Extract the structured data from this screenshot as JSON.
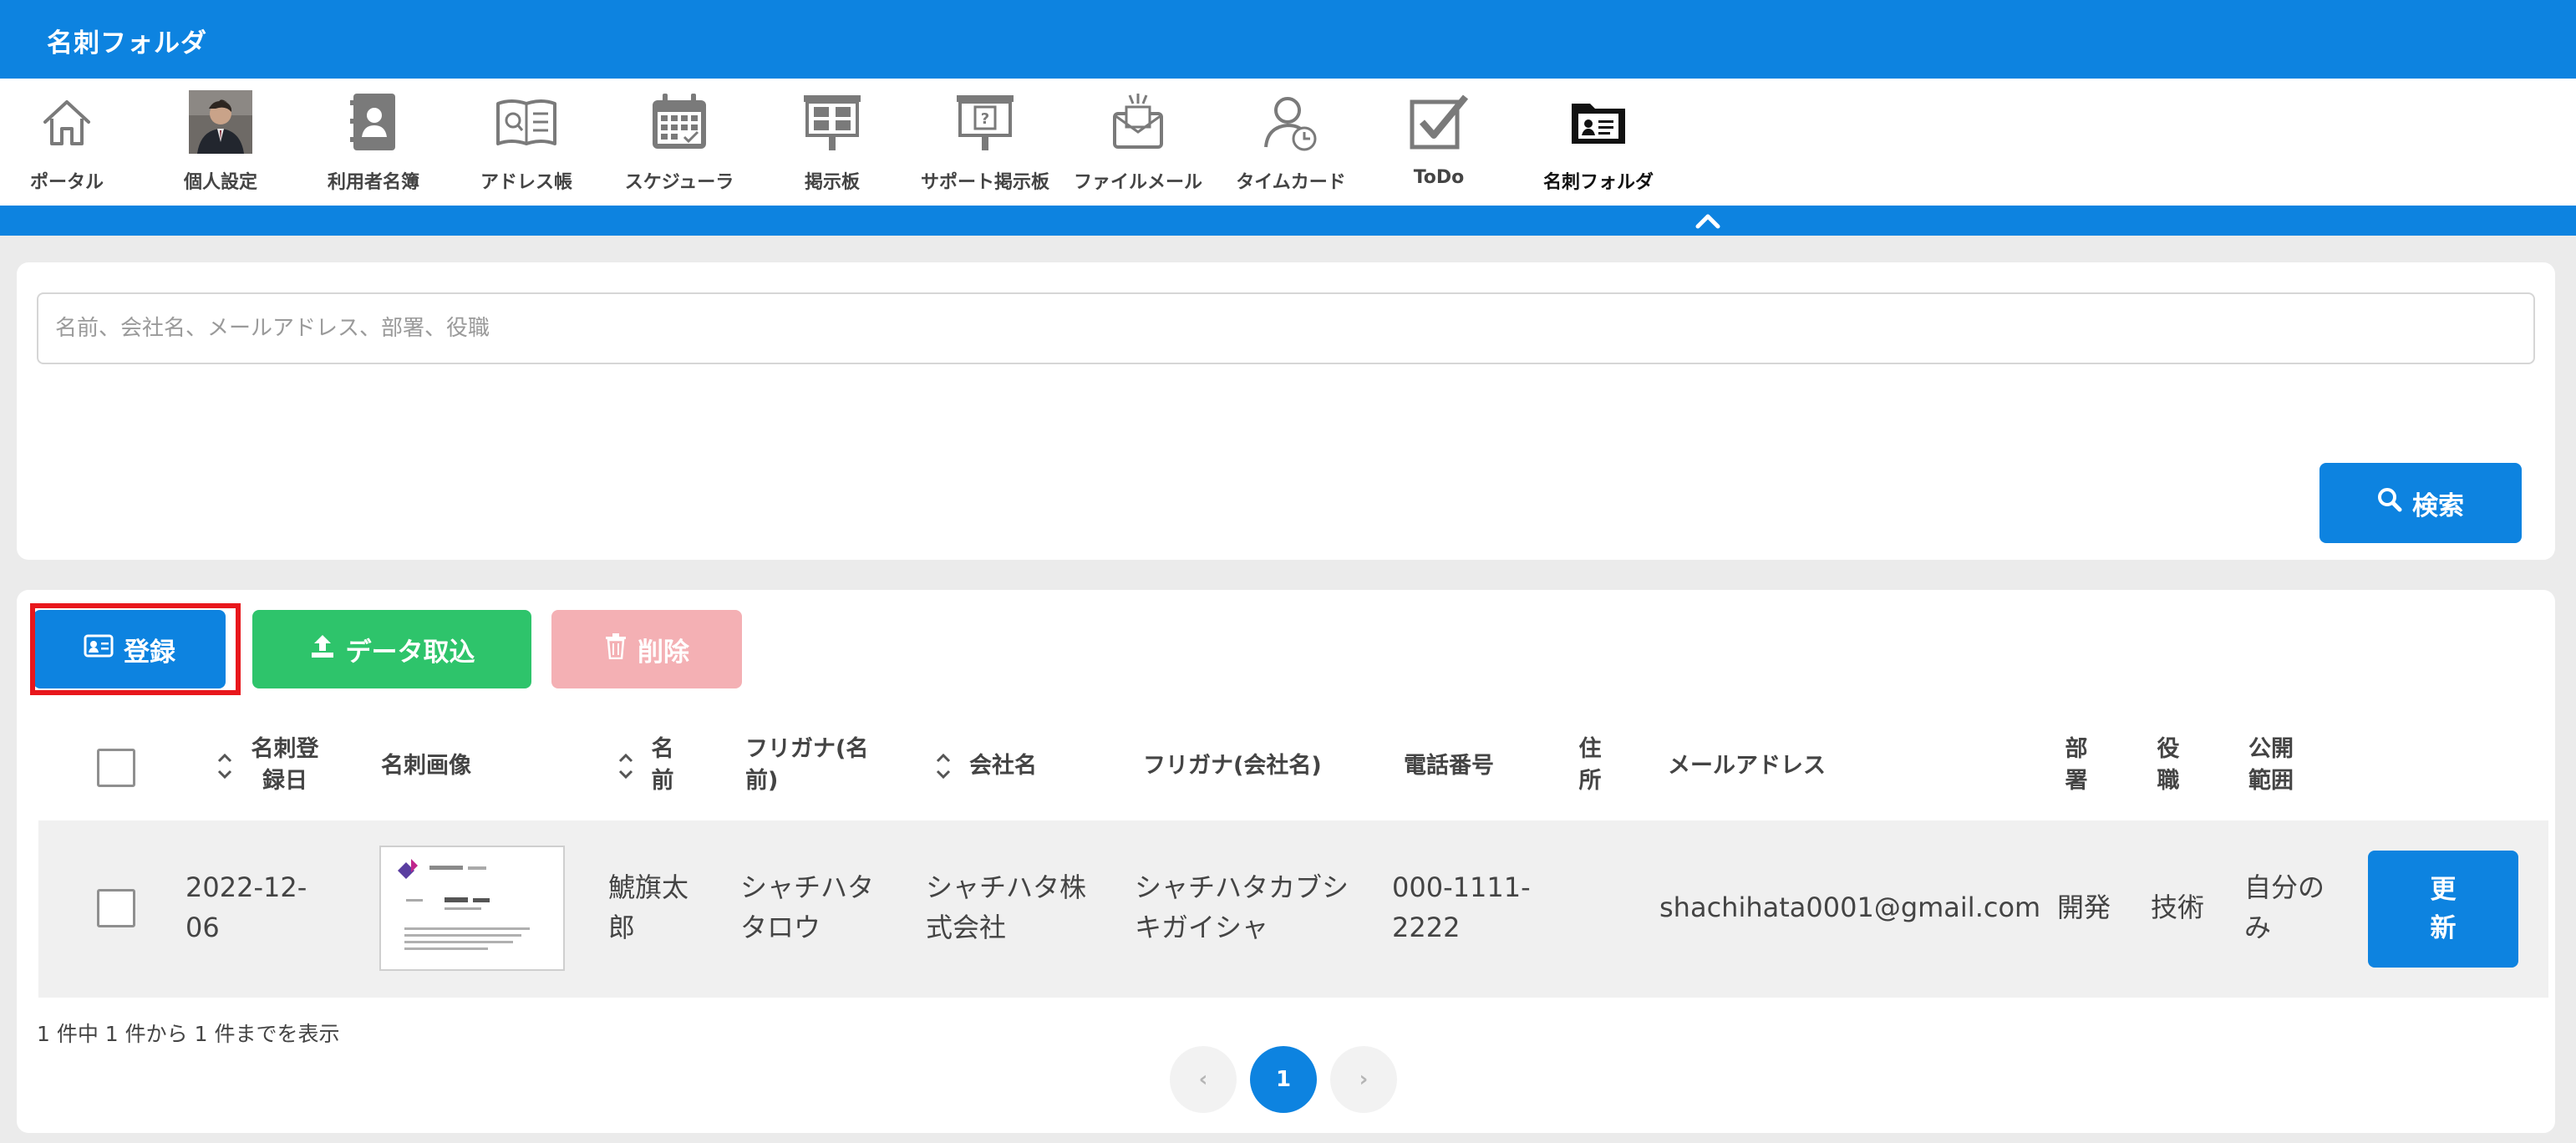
{
  "app": {
    "title": "名刺フォルダ"
  },
  "nav": {
    "items": [
      {
        "label": "ポータル",
        "icon": "home-icon"
      },
      {
        "label": "個人設定",
        "icon": "user-photo-icon"
      },
      {
        "label": "利用者名簿",
        "icon": "contact-book-icon"
      },
      {
        "label": "アドレス帳",
        "icon": "address-book-icon"
      },
      {
        "label": "スケジューラ",
        "icon": "calendar-icon"
      },
      {
        "label": "掲示板",
        "icon": "bulletin-board-icon"
      },
      {
        "label": "サポート掲示板",
        "icon": "support-board-icon"
      },
      {
        "label": "ファイルメール",
        "icon": "file-mail-icon"
      },
      {
        "label": "タイムカード",
        "icon": "time-card-icon"
      },
      {
        "label": "ToDo",
        "icon": "todo-check-icon"
      },
      {
        "label": "名刺フォルダ",
        "icon": "business-card-folder-icon",
        "active": true
      }
    ]
  },
  "search": {
    "placeholder": "名前、会社名、メールアドレス、部署、役職",
    "value": "",
    "button_label": "検索"
  },
  "actions": {
    "register_label": "登録",
    "import_label": "データ取込",
    "delete_label": "削除"
  },
  "table": {
    "columns": {
      "registered_date": "名刺登録日",
      "card_image": "名刺画像",
      "name": "名前",
      "name_kana": "フリガナ(名前)",
      "company": "会社名",
      "company_kana": "フリガナ(会社名)",
      "phone": "電話番号",
      "address": "住所",
      "email": "メールアドレス",
      "department": "部署",
      "position": "役職",
      "visibility": "公開範囲"
    },
    "rows": [
      {
        "registered_date": "2022-12-06",
        "name": "鯱旗太郎",
        "name_kana": "シャチハタタロウ",
        "company": "シャチハタ株式会社",
        "company_kana": "シャチハタカブシキガイシャ",
        "phone": "000-1111-2222",
        "address": "",
        "email": "shachihata0001@gmail.com",
        "department": "開発",
        "position": "技術",
        "visibility": "自分のみ",
        "update_label": "更新"
      }
    ]
  },
  "pagination": {
    "summary": "1 件中 1 件から 1 件までを表示",
    "current_page": "1",
    "prev_symbol": "‹",
    "next_symbol": "›"
  },
  "colors": {
    "primary": "#0d83e0",
    "success": "#2ec46b",
    "danger_disabled": "#f4b0b4",
    "highlight": "#e8171c"
  }
}
